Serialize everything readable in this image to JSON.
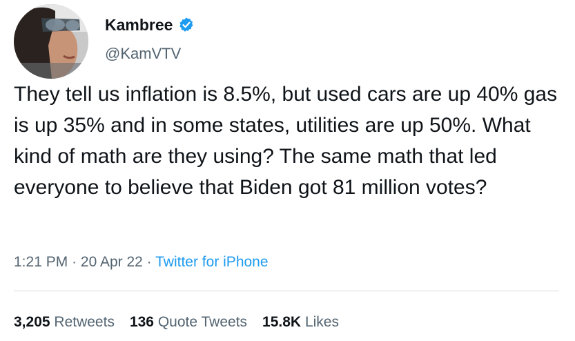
{
  "author": {
    "display_name": "Kambree",
    "handle": "@KamVTV",
    "verified_icon": "verified-badge-icon",
    "verified_color": "#1d9bf0"
  },
  "tweet": {
    "text": "They tell us inflation is 8.5%, but used cars are up 40% gas is up 35% and in some states, utilities are up 50%. What kind of math are they using? The same math that led everyone to believe that Biden got 81 million votes?"
  },
  "meta": {
    "time": "1:21 PM",
    "separator": "·",
    "date": "20 Apr 22",
    "source": "Twitter for iPhone"
  },
  "stats": {
    "retweets_count": "3,205",
    "retweets_label": "Retweets",
    "quote_count": "136",
    "quote_label": "Quote Tweets",
    "likes_count": "15.8K",
    "likes_label": "Likes"
  },
  "colors": {
    "text": "#0f1419",
    "secondary": "#536471",
    "link": "#1d9bf0",
    "divider": "#d7dbdc"
  }
}
